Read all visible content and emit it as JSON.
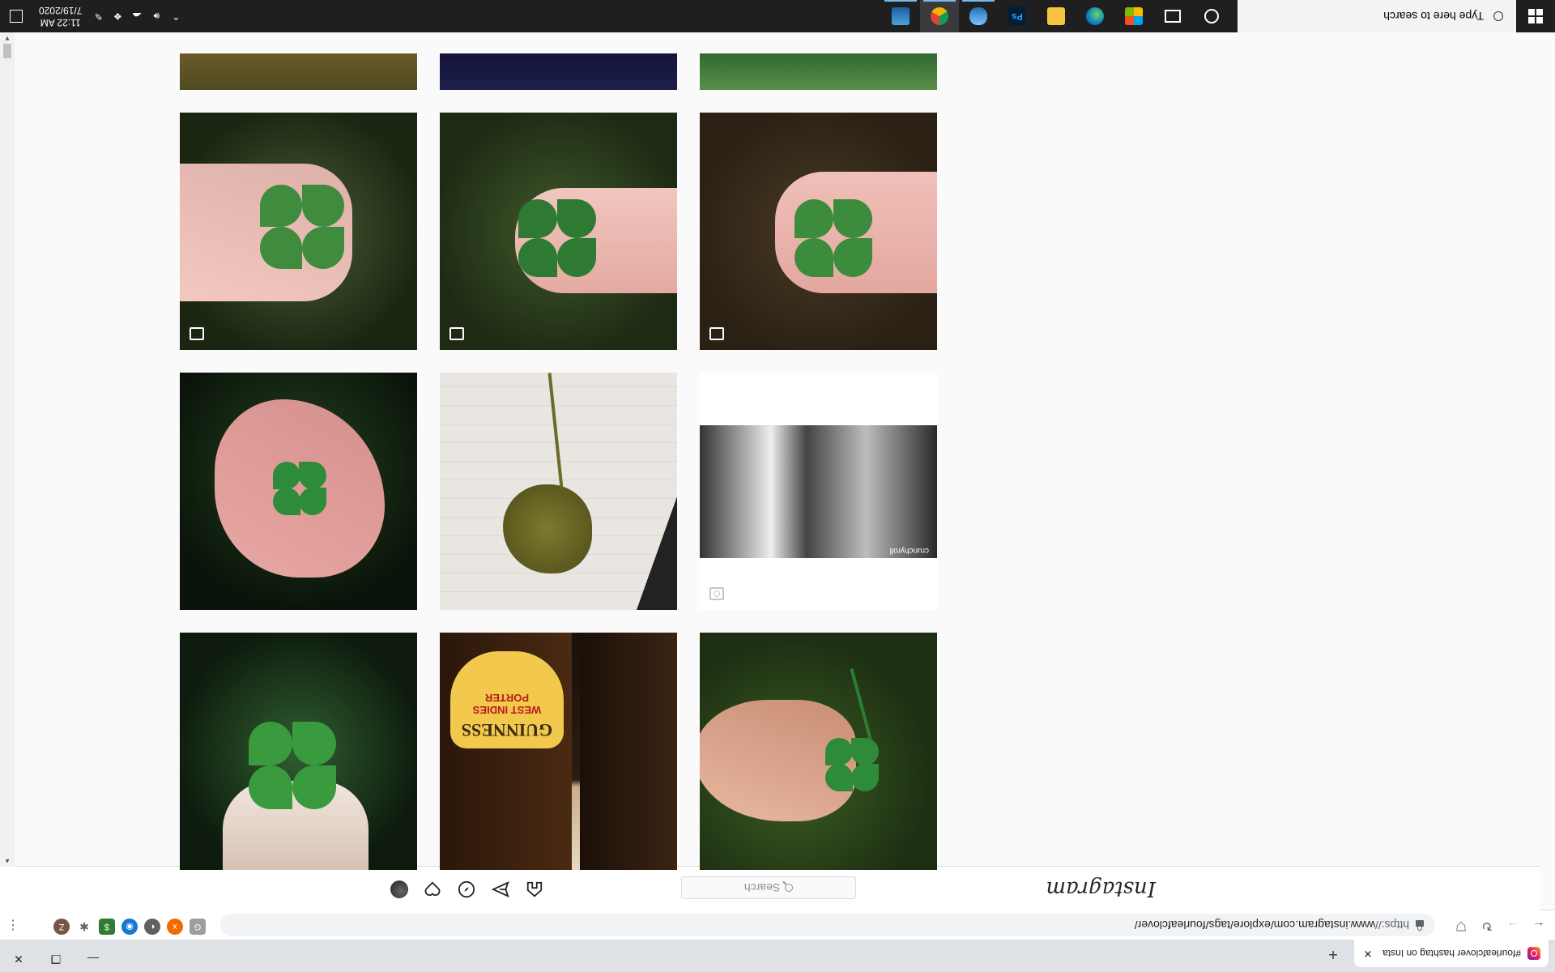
{
  "browser": {
    "tab_title": "#fourleafclover hashtag on Insta",
    "tab_close": "✕",
    "new_tab": "+",
    "url_scheme": "https://",
    "url_rest": "www.instagram.com/explore/tags/fourleafclover/",
    "profile_initial": "Z",
    "window_buttons": [
      "—",
      "❐",
      "✕"
    ]
  },
  "instagram": {
    "logo": "Instagram",
    "search_placeholder": "Search"
  },
  "grid": {
    "tiles": [
      {
        "kind": "clover-hand-grass",
        "badge": "multiple"
      },
      {
        "kind": "guinness-bottles",
        "bottle_text": "GUINNESS",
        "bottle_sub": "WEST INDIES PORTER"
      },
      {
        "kind": "clover-hand-dark"
      },
      {
        "kind": "anime-video",
        "badge": "camera",
        "watermark": "crunchyroll"
      },
      {
        "kind": "pressed-clover"
      },
      {
        "kind": "clover-palm"
      },
      {
        "kind": "clover-fingers",
        "badge": "multiple"
      },
      {
        "kind": "clover-fingers-wet",
        "badge": "multiple"
      },
      {
        "kind": "clover-fingers-soil",
        "badge": "multiple"
      },
      {
        "kind": "partial"
      },
      {
        "kind": "partial"
      },
      {
        "kind": "partial"
      }
    ]
  },
  "taskbar": {
    "search_placeholder": "Type here to search",
    "time": "11:22 AM",
    "date": "7/19/2020"
  },
  "colors": {
    "ig_border": "#dbdbdb",
    "taskbar": "#1f1f1f",
    "tab_strip": "#dee1e6"
  }
}
